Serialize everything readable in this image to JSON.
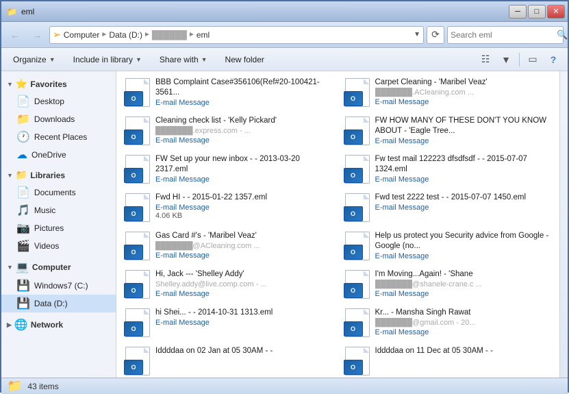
{
  "titlebar": {
    "title": "eml",
    "min_label": "─",
    "max_label": "□",
    "close_label": "✕"
  },
  "navbar": {
    "back_tooltip": "Back",
    "forward_tooltip": "Forward",
    "address": {
      "parts": [
        "Computer",
        "Data (D:)",
        "...",
        "eml"
      ],
      "separators": [
        "▶",
        "▶",
        "▶"
      ]
    },
    "search_placeholder": "Search eml"
  },
  "toolbar": {
    "organize_label": "Organize",
    "include_label": "Include in library",
    "share_label": "Share with",
    "new_folder_label": "New folder"
  },
  "sidebar": {
    "favorites_label": "Favorites",
    "desktop_label": "Desktop",
    "downloads_label": "Downloads",
    "recent_label": "Recent Places",
    "onedrive_label": "OneDrive",
    "libraries_label": "Libraries",
    "documents_label": "Documents",
    "music_label": "Music",
    "pictures_label": "Pictures",
    "videos_label": "Videos",
    "computer_label": "Computer",
    "windows_label": "Windows7 (C:)",
    "data_label": "Data (D:)",
    "network_label": "Network"
  },
  "files": [
    {
      "name": "BBB Complaint Case#356106(Ref#20-100421-3561...",
      "subname": "",
      "type": "E-mail Message",
      "size": ""
    },
    {
      "name": "Carpet Cleaning - 'Maribel Veaz'",
      "subname": "██████████.ACleaning.com  ...",
      "type": "E-mail Message",
      "size": ""
    },
    {
      "name": "Cleaning check list - 'Kelly Pickard'",
      "subname": "██████████.express.com - ...",
      "type": "E-mail Message",
      "size": ""
    },
    {
      "name": "FW  HOW MANY OF THESE DON'T YOU KNOW ABOUT  - 'Eagle Tree...",
      "subname": "",
      "type": "E-mail Message",
      "size": ""
    },
    {
      "name": "FW  Set up your new inbox -  - 2013-03-20 2317.eml",
      "subname": "",
      "type": "E-mail Message",
      "size": ""
    },
    {
      "name": "Fw  test mail 122223 dfsdfsdf -  - 2015-07-07 1324.eml",
      "subname": "",
      "type": "E-mail Message",
      "size": ""
    },
    {
      "name": "Fwd  HI -  - 2015-01-22 1357.eml",
      "subname": "",
      "type": "E-mail Message",
      "size": "4.06 KB"
    },
    {
      "name": "Fwd  test 2222 test -  - 2015-07-07 1450.eml",
      "subname": "",
      "type": "E-mail Message",
      "size": ""
    },
    {
      "name": "Gas Card #'s - 'Maribel Veaz'",
      "subname": "██████████@ACleaning.com ...",
      "type": "E-mail Message",
      "size": ""
    },
    {
      "name": "Help us protect you  Security advice from Google - Google (no...",
      "subname": "",
      "type": "E-mail Message",
      "size": ""
    },
    {
      "name": "Hi, Jack --- 'Shelley Addy'",
      "subname": "Shelley.addy@live.comp.com - ...",
      "type": "E-mail Message",
      "size": ""
    },
    {
      "name": "I'm Moving...Again! - 'Shane",
      "subname": "██████████@shanele-crane.c ...",
      "type": "E-mail Message",
      "size": ""
    },
    {
      "name": "hi Shei... -  - 2014-10-31 1313.eml",
      "subname": "",
      "type": "E-mail Message",
      "size": ""
    },
    {
      "name": "Kr... - Mansha Singh Rawat",
      "subname": "██████████@gmail.com  - 20...",
      "type": "E-mail Message",
      "size": ""
    },
    {
      "name": "Iddddaa on 02 Jan at 05 30AM -  - ",
      "subname": "",
      "type": "",
      "size": ""
    },
    {
      "name": "Iddddaa on 11 Dec at 05 30AM -  - ",
      "subname": "",
      "type": "",
      "size": ""
    }
  ],
  "statusbar": {
    "count": "43 items"
  }
}
